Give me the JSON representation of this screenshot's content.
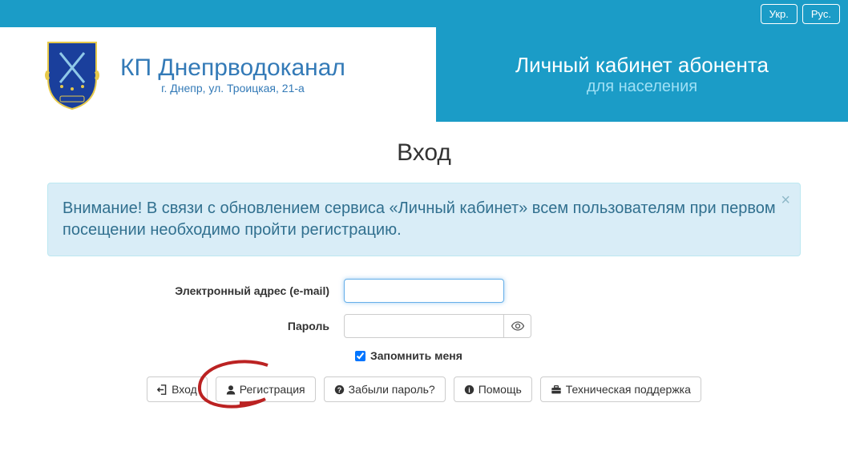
{
  "topbar": {
    "lang_ukr": "Укр.",
    "lang_rus": "Рус."
  },
  "brand": {
    "name": "КП Днепрводоканал",
    "address": "г. Днепр, ул. Троицкая, 21-а"
  },
  "header_right": {
    "title": "Личный кабинет абонента",
    "subtitle": "для населения"
  },
  "page": {
    "title": "Вход",
    "alert": "Внимание! В связи с обновлением сервиса «Личный кабинет» всем пользователям при первом посещении необходимо пройти регистрацию.",
    "alert_close": "×"
  },
  "form": {
    "email_label": "Электронный адрес (e-mail)",
    "email_value": "",
    "password_label": "Пароль",
    "password_value": "",
    "remember_label": "Запомнить меня"
  },
  "buttons": {
    "login": "Вход",
    "register": "Регистрация",
    "forgot": "Забыли пароль?",
    "help": "Помощь",
    "support": "Техническая поддержка"
  }
}
